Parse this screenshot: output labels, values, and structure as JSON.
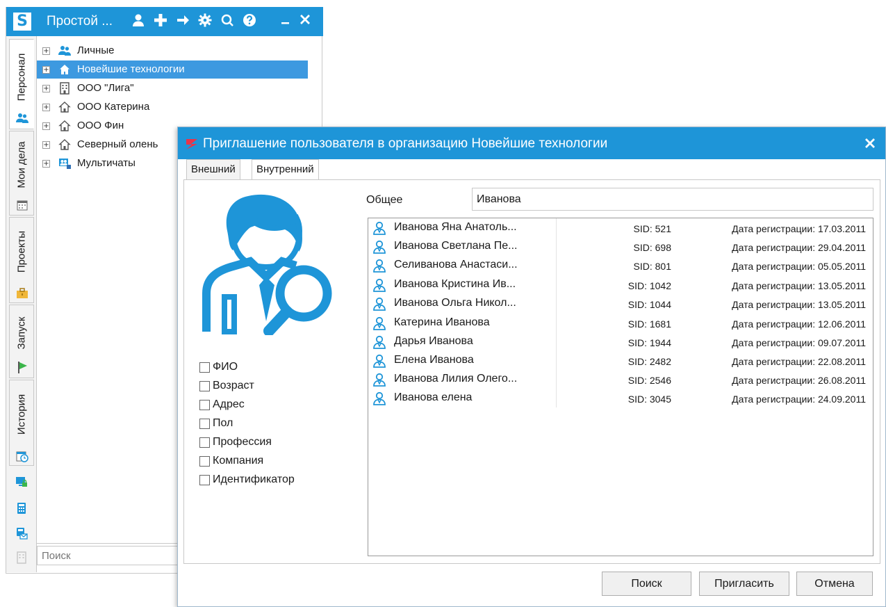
{
  "main_window": {
    "title": "Простой ...",
    "logo": "S",
    "toolbar_icons": [
      "user-icon",
      "add-icon",
      "arrow-right-icon",
      "gear-icon",
      "search-icon",
      "help-icon",
      "minimize-icon",
      "close-icon"
    ],
    "vertical_tabs": [
      {
        "label": "Персонал",
        "icon": "people-icon",
        "active": true
      },
      {
        "label": "Мои дела",
        "icon": "calendar-icon",
        "active": false
      },
      {
        "label": "Проекты",
        "icon": "briefcase-icon",
        "active": false
      },
      {
        "label": "Запуск",
        "icon": "flag-icon",
        "active": false
      },
      {
        "label": "История",
        "icon": "history-calendar-icon",
        "active": false
      }
    ],
    "side_icons": [
      "lock-monitor-icon",
      "calculator-icon",
      "calculator-mail-icon"
    ],
    "tree": [
      {
        "label": "Личные",
        "icon": "people-icon",
        "selected": false
      },
      {
        "label": "Новейшие технологии",
        "icon": "home-icon",
        "selected": true
      },
      {
        "label": "ООО \"Лига\"",
        "icon": "building-icon",
        "selected": false
      },
      {
        "label": "ООО Катерина",
        "icon": "home-outline-icon",
        "selected": false
      },
      {
        "label": "ООО Фин",
        "icon": "home-outline-icon",
        "selected": false
      },
      {
        "label": "Северный олень",
        "icon": "home-outline-icon",
        "selected": false
      },
      {
        "label": "Мультичаты",
        "icon": "multichat-icon",
        "selected": false
      }
    ],
    "search_placeholder": "Поиск"
  },
  "dialog": {
    "title": "Приглашение пользователя в организацию Новейшие технологии",
    "tabs": [
      {
        "label": "Внешний",
        "active": false
      },
      {
        "label": "Внутренний",
        "active": true
      }
    ],
    "checkboxes": [
      {
        "label": "ФИО",
        "checked": false
      },
      {
        "label": "Возраст",
        "checked": false
      },
      {
        "label": "Адрес",
        "checked": false
      },
      {
        "label": "Пол",
        "checked": false
      },
      {
        "label": "Профессия",
        "checked": false
      },
      {
        "label": "Компания",
        "checked": false
      },
      {
        "label": "Идентификатор",
        "checked": false
      }
    ],
    "general_label": "Общее",
    "general_value": "Иванова",
    "results": [
      {
        "name": "Иванова Яна Анатоль...",
        "sid": "SID: 521",
        "date": "Дата регистрации: 17.03.2011"
      },
      {
        "name": "Иванова Светлана Пе...",
        "sid": "SID: 698",
        "date": "Дата регистрации: 29.04.2011"
      },
      {
        "name": "Селиванова Анастаси...",
        "sid": "SID: 801",
        "date": "Дата регистрации: 05.05.2011"
      },
      {
        "name": "Иванова Кристина Ив...",
        "sid": "SID: 1042",
        "date": "Дата регистрации: 13.05.2011"
      },
      {
        "name": "Иванова Ольга Никол...",
        "sid": "SID: 1044",
        "date": "Дата регистрации: 13.05.2011"
      },
      {
        "name": "Катерина Иванова",
        "sid": "SID: 1681",
        "date": "Дата регистрации: 12.06.2011"
      },
      {
        "name": "Дарья Иванова",
        "sid": "SID: 1944",
        "date": "Дата регистрации: 09.07.2011"
      },
      {
        "name": "Елена Иванова",
        "sid": "SID: 2482",
        "date": "Дата регистрации: 22.08.2011"
      },
      {
        "name": "Иванова Лилия Олего...",
        "sid": "SID: 2546",
        "date": "Дата регистрации: 26.08.2011"
      },
      {
        "name": "Иванова елена",
        "sid": "SID: 3045",
        "date": "Дата регистрации: 24.09.2011"
      }
    ],
    "buttons": {
      "search": "Поиск",
      "invite": "Пригласить",
      "cancel": "Отмена"
    }
  },
  "colors": {
    "accent": "#1e95d8",
    "selection": "#3d99e0"
  }
}
